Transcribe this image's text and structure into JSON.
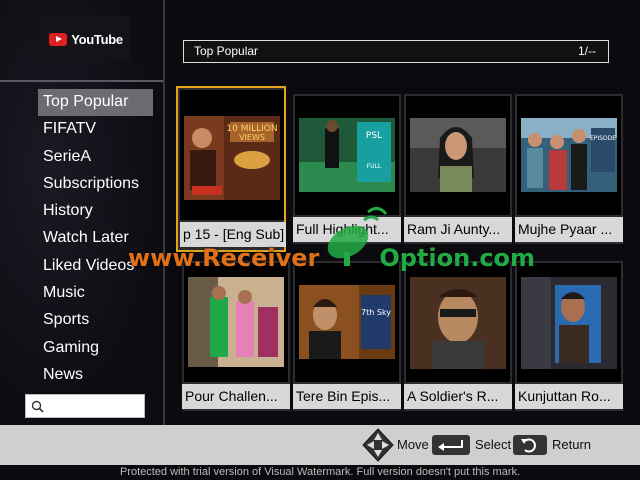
{
  "app": {
    "name": "YouTube"
  },
  "sidebar": {
    "items": [
      {
        "label": "Top Popular",
        "active": true
      },
      {
        "label": "FIFATV"
      },
      {
        "label": "SerieA"
      },
      {
        "label": "Subscriptions"
      },
      {
        "label": "History"
      },
      {
        "label": "Watch Later"
      },
      {
        "label": "Liked Videos"
      },
      {
        "label": "Music"
      },
      {
        "label": "Sports"
      },
      {
        "label": "Gaming"
      },
      {
        "label": "News"
      }
    ],
    "search": {
      "value": "",
      "icon": "search-icon"
    }
  },
  "header": {
    "title": "Top Popular",
    "page": "1/--"
  },
  "videos": [
    {
      "title": "p 15 - [Eng Sub]",
      "selected": true
    },
    {
      "title": "Full Highlight..."
    },
    {
      "title": "Ram Ji Aunty..."
    },
    {
      "title": "Mujhe Pyaar ..."
    },
    {
      "title": "Pour Challen..."
    },
    {
      "title": "Tere Bin Epis..."
    },
    {
      "title": "A Soldier's R..."
    },
    {
      "title": "Kunjuttan Ro..."
    }
  ],
  "watermark": {
    "left": "www.Receiver",
    "right": "Option.com"
  },
  "footer": {
    "hints": [
      {
        "icon": "dpad-icon",
        "label": "Move"
      },
      {
        "icon": "enter-icon",
        "label": "Select"
      },
      {
        "icon": "return-icon",
        "label": "Return"
      }
    ],
    "notice": "Protected with trial version of Visual Watermark. Full version doesn't put this mark."
  },
  "colors": {
    "selection": "#e3a41c",
    "youtube_red": "#e02020",
    "panel_gray": "#cfcfcf"
  }
}
